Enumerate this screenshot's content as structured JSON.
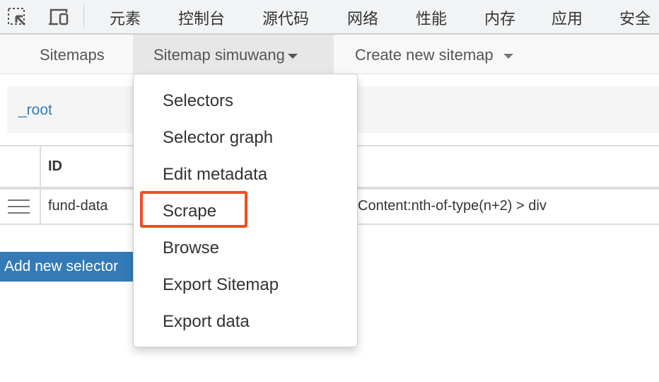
{
  "devtools": {
    "tabs": [
      "元素",
      "控制台",
      "源代码",
      "网络",
      "性能",
      "内存",
      "应用",
      "安全"
    ],
    "icons": [
      "inspect-element-icon",
      "device-toolbar-icon"
    ]
  },
  "nav": {
    "sitemaps": "Sitemaps",
    "current_sitemap": "Sitemap simuwang",
    "create": "Create new sitemap"
  },
  "breadcrumb": {
    "root": "_root"
  },
  "table": {
    "headers": [
      "ID"
    ],
    "rows": [
      {
        "id": "fund-data",
        "selector": "Content:nth-of-type(n+2) > div"
      }
    ]
  },
  "add_button": "Add new selector",
  "dropdown": {
    "items": [
      "Selectors",
      "Selector graph",
      "Edit metadata",
      "Scrape",
      "Browse",
      "Export Sitemap",
      "Export data"
    ],
    "highlighted": "Scrape",
    "highlight_color": "#f04e23"
  },
  "colors": {
    "link": "#337ab7",
    "button": "#337ab7"
  }
}
